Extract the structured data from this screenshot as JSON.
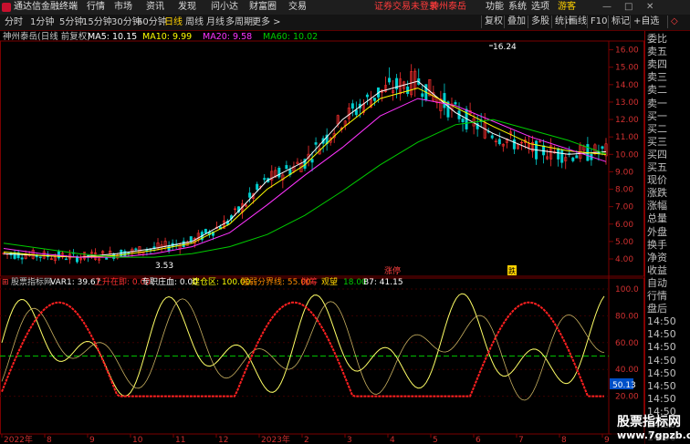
{
  "app": {
    "title": "通达信金融终端"
  },
  "menu": [
    "行情",
    "市场",
    "资讯",
    "发现",
    "问小达",
    "财富圈",
    "交易"
  ],
  "notice": "证券交易未登录",
  "stock_title": "神州泰岳",
  "titlebar_right": [
    "功能",
    "系统",
    "选项"
  ],
  "guest": "游客",
  "period_tabs": [
    {
      "label": "分时",
      "active": false
    },
    {
      "label": "1分钟",
      "active": false
    },
    {
      "label": "5分钟",
      "active": false
    },
    {
      "label": "15分钟",
      "active": false
    },
    {
      "label": "30分钟",
      "active": false
    },
    {
      "label": "60分钟",
      "active": false
    },
    {
      "label": "日线",
      "active": true
    },
    {
      "label": "周线",
      "active": false
    },
    {
      "label": "月线",
      "active": false
    },
    {
      "label": "多周期",
      "active": false
    },
    {
      "label": "更多 >",
      "active": false
    }
  ],
  "toolbar_right": [
    "复权",
    "叠加",
    "多股",
    "统计",
    "画线",
    "F10",
    "标记",
    "+自选",
    "◇"
  ],
  "chart_header": {
    "stock": "神州泰岳(日线 前复权)",
    "ma5": "MA5: 10.15",
    "ma10": "MA10: 9.99",
    "ma20": "MA20: 9.58",
    "ma60": "MA60: 10.02"
  },
  "indicator_header": {
    "name": "股票指标网",
    "var1": "VAR1: 39.67",
    "rise": "上升在即: 0.00",
    "bank": "专职庄血: 0.00",
    "build": "建仓区: 100.00",
    "strong_weak": "强弱分界线: 55.00",
    "sell": "抛筹",
    "watch": "观望",
    "v18": "18.00",
    "b7": "B7: 41.15"
  },
  "price_axis": [
    "16.00",
    "15.00",
    "14.00",
    "13.00",
    "12.00",
    "11.00",
    "10.00",
    "9.00",
    "8.00",
    "7.00",
    "6.00",
    "5.00",
    "4.00"
  ],
  "indicator_axis": [
    "100.0",
    "80.00",
    "60.00",
    "40.00",
    "20.00"
  ],
  "indicator_badge": "50.13",
  "date_axis": [
    "2022年",
    "8",
    "9",
    "10",
    "11",
    "12",
    "2023年",
    "2",
    "3",
    "4",
    "5",
    "6",
    "7",
    "8",
    "9"
  ],
  "chart_annotations": {
    "high": "16.24",
    "low": "3.53",
    "event1": "涨停",
    "event2": "跌"
  },
  "right_panel": [
    "委比",
    "卖五",
    "卖四",
    "卖三",
    "卖二",
    "卖一",
    "买一",
    "买二",
    "买三",
    "买四",
    "买五",
    "现价",
    "涨跌",
    "涨幅",
    "总量",
    "外盘",
    "换手",
    "净资",
    "收益",
    "自动",
    "行情",
    "盘后",
    "14:50",
    "14:50",
    "14:50",
    "14:50",
    "14:50",
    "14:50",
    "14:50",
    "14:50",
    "14:50",
    "14:50"
  ],
  "watermark": {
    "line1": "股票指标网",
    "line2": "www.7gpzb.com"
  },
  "colors": {
    "bg": "#000000",
    "up": "#ff3030",
    "down": "#00d0d0",
    "ma5": "#ffffff",
    "ma10": "#ffff00",
    "ma20": "#ff33ff",
    "ma60": "#00cc00",
    "accent": "#ffd200"
  },
  "chart_data": {
    "type": "line",
    "title": "神州泰岳(日线 前复权)",
    "x_range": [
      "2022年",
      "9"
    ],
    "y_range": [
      3.53,
      16.24
    ],
    "series": [
      {
        "name": "MA5",
        "values": [
          4.3,
          4.2,
          4.1,
          4.3,
          4.6,
          5.0,
          6.2,
          8.5,
          9.6,
          12.0,
          13.6,
          14.2,
          12.4,
          11.2,
          10.3,
          10.0,
          10.15
        ]
      },
      {
        "name": "MA10",
        "values": [
          4.4,
          4.2,
          4.1,
          4.2,
          4.5,
          4.9,
          6.0,
          8.0,
          9.4,
          11.5,
          13.2,
          13.8,
          12.7,
          11.6,
          10.6,
          10.2,
          9.99
        ]
      },
      {
        "name": "MA20",
        "values": [
          4.6,
          4.3,
          4.1,
          4.1,
          4.3,
          4.7,
          5.5,
          7.1,
          8.8,
          10.4,
          12.2,
          13.2,
          12.8,
          11.9,
          11.0,
          10.3,
          9.58
        ]
      },
      {
        "name": "MA60",
        "values": [
          4.9,
          4.6,
          4.3,
          4.1,
          4.1,
          4.3,
          4.7,
          5.4,
          6.5,
          7.9,
          9.4,
          10.7,
          11.7,
          12.0,
          11.4,
          10.8,
          10.02
        ]
      }
    ]
  }
}
